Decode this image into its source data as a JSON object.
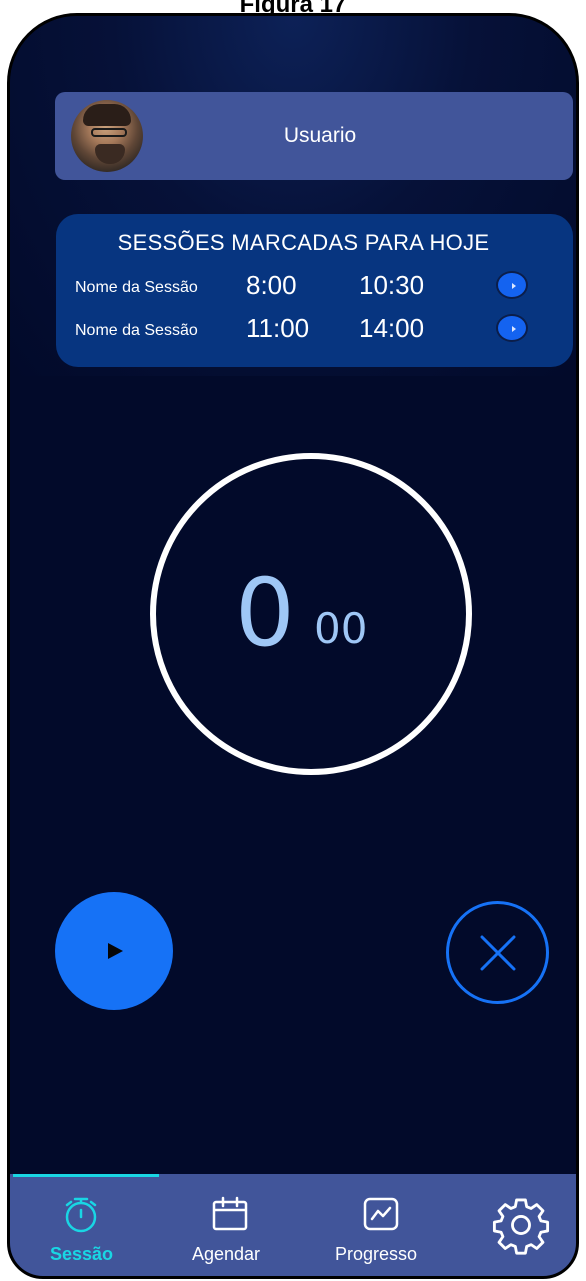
{
  "figure_caption": "Figura 17",
  "user": {
    "name": "Usuario"
  },
  "sessions": {
    "title": "SESSÕES MARCADAS PARA HOJE",
    "items": [
      {
        "name": "Nome da Sessão",
        "start": "8:00",
        "end": "10:30"
      },
      {
        "name": "Nome da Sessão",
        "start": "11:00",
        "end": "14:00"
      }
    ]
  },
  "timer": {
    "main": "0",
    "sub": "00"
  },
  "controls": {
    "play_icon": "play-icon",
    "cancel_icon": "close-icon"
  },
  "nav": {
    "items": [
      {
        "label": "Sessão",
        "icon": "stopwatch-icon",
        "active": true
      },
      {
        "label": "Agendar",
        "icon": "calendar-icon",
        "active": false
      },
      {
        "label": "Progresso",
        "icon": "chart-icon",
        "active": false
      },
      {
        "label": "",
        "icon": "gear-icon",
        "active": false
      }
    ]
  },
  "colors": {
    "background": "#020a2a",
    "card": "#41559a",
    "sessions_card": "#073580",
    "accent_blue": "#1672f6",
    "timer_text": "#9fc7f6",
    "active_nav": "#19d6e4"
  }
}
